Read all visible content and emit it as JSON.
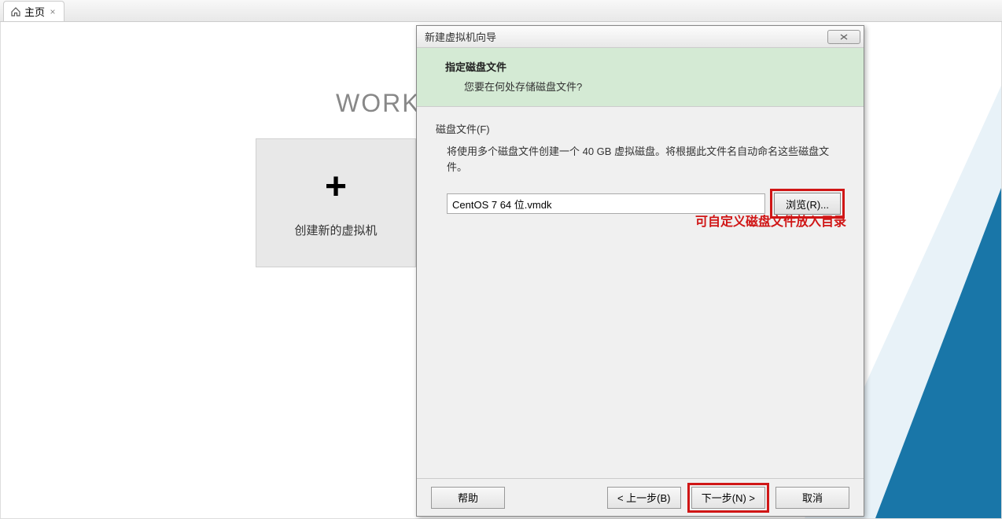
{
  "tab": {
    "label": "主页"
  },
  "workstation": {
    "partial_text": "WORK"
  },
  "tile": {
    "create_vm_label": "创建新的虚拟机"
  },
  "dialog": {
    "title": "新建虚拟机向导",
    "close_symbol": "✕",
    "header": {
      "title": "指定磁盘文件",
      "subtitle": "您要在何处存储磁盘文件?"
    },
    "body": {
      "fieldset_label": "磁盘文件(F)",
      "description": "将使用多个磁盘文件创建一个 40 GB 虚拟磁盘。将根据此文件名自动命名这些磁盘文件。",
      "input_value": "CentOS 7 64 位.vmdk",
      "browse_label": "浏览(R)..."
    },
    "annotation": "可自定义磁盘文件放入目录",
    "footer": {
      "help_label": "帮助",
      "back_label": "< 上一步(B)",
      "next_label": "下一步(N) >",
      "cancel_label": "取消"
    }
  }
}
